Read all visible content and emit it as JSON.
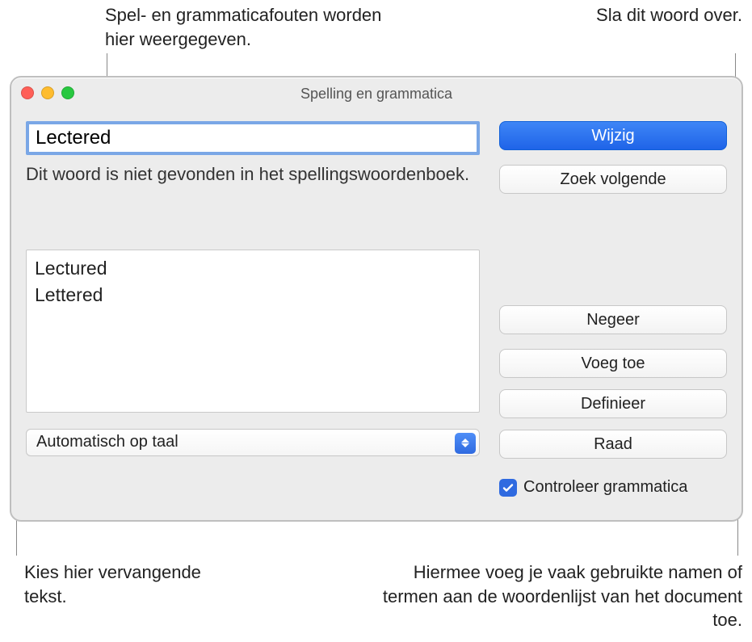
{
  "callouts": {
    "errors_shown_here": "Spel- en grammaticafouten worden hier weergegeven.",
    "skip_word": "Sla dit woord over.",
    "choose_replacement": "Kies hier vervangende tekst.",
    "add_frequent": "Hiermee voeg je vaak gebruikte namen of termen aan de woordenlijst van het document toe."
  },
  "window": {
    "title": "Spelling en grammatica"
  },
  "error_field": {
    "value": "Lectered"
  },
  "description": "Dit woord is niet gevonden in het spellingswoordenboek.",
  "suggestions": [
    "Lectured",
    "Lettered"
  ],
  "language_select": {
    "selected": "Automatisch op taal"
  },
  "buttons": {
    "change": "Wijzig",
    "find_next": "Zoek volgende",
    "ignore": "Negeer",
    "learn": "Voeg toe",
    "define": "Definieer",
    "guess": "Raad"
  },
  "checkbox": {
    "check_grammar": "Controleer grammatica",
    "checked": true
  }
}
